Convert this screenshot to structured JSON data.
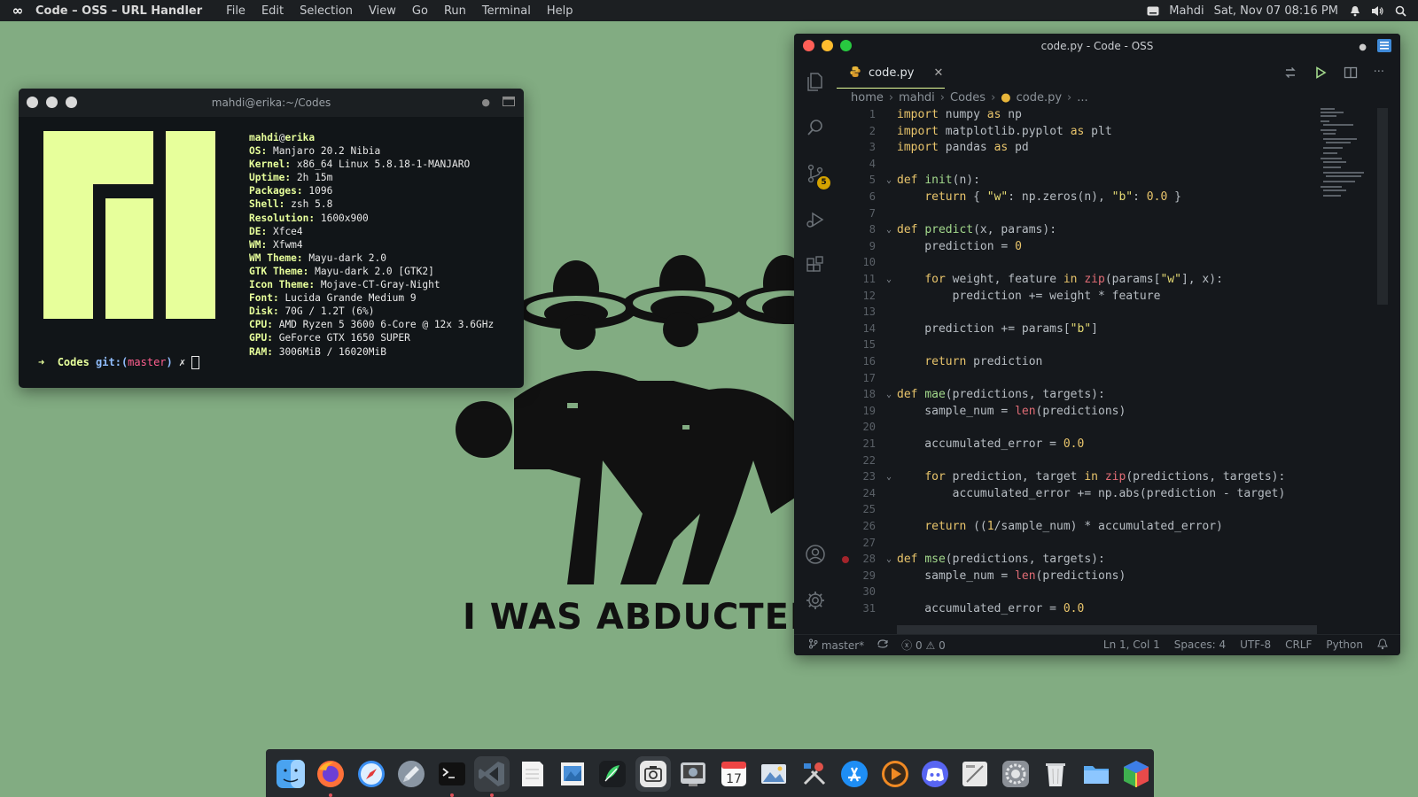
{
  "topbar": {
    "app_title": "Code – OSS – URL Handler",
    "menus": [
      "File",
      "Edit",
      "Selection",
      "View",
      "Go",
      "Run",
      "Terminal",
      "Help"
    ],
    "user": "Mahdi",
    "clock": "Sat, Nov 07 08:16 PM"
  },
  "wallpaper": {
    "caption": "I WAS ABDUCTED BY"
  },
  "terminal": {
    "title": "mahdi@erika:~/Codes",
    "user": "mahdi",
    "at": "@",
    "host": "erika",
    "info": [
      {
        "key": "OS:",
        "value": "Manjaro 20.2 Nibia"
      },
      {
        "key": "Kernel:",
        "value": "x86_64 Linux 5.8.18-1-MANJARO"
      },
      {
        "key": "Uptime:",
        "value": "2h 15m"
      },
      {
        "key": "Packages:",
        "value": "1096"
      },
      {
        "key": "Shell:",
        "value": "zsh 5.8"
      },
      {
        "key": "Resolution:",
        "value": "1600x900"
      },
      {
        "key": "DE:",
        "value": "Xfce4"
      },
      {
        "key": "WM:",
        "value": "Xfwm4"
      },
      {
        "key": "WM Theme:",
        "value": "Mayu-dark 2.0"
      },
      {
        "key": "GTK Theme:",
        "value": "Mayu-dark 2.0 [GTK2]"
      },
      {
        "key": "Icon Theme:",
        "value": "Mojave-CT-Gray-Night"
      },
      {
        "key": "Font:",
        "value": "Lucida Grande Medium 9"
      },
      {
        "key": "Disk:",
        "value": "70G / 1.2T (6%)"
      },
      {
        "key": "CPU:",
        "value": "AMD Ryzen 5 3600 6-Core @ 12x 3.6GHz"
      },
      {
        "key": "GPU:",
        "value": "GeForce GTX 1650 SUPER"
      },
      {
        "key": "RAM:",
        "value": "3006MiB / 16020MiB"
      }
    ],
    "prompt": {
      "arrow": "➜",
      "dir": "Codes",
      "git": "git:(",
      "branch": "master",
      "close": ")",
      "dirty": "✗"
    }
  },
  "vscode": {
    "title": "code.py - Code - OSS",
    "tab_label": "code.py",
    "scm_badge": "5",
    "breadcrumb": [
      "home",
      "mahdi",
      "Codes",
      "code.py",
      "..."
    ],
    "code_lines": [
      "import numpy as np",
      "import matplotlib.pyplot as plt",
      "import pandas as pd",
      "",
      "def init(n):",
      "    return { \"w\": np.zeros(n), \"b\": 0.0 }",
      "",
      "def predict(x, params):",
      "    prediction = 0",
      "",
      "    for weight, feature in zip(params[\"w\"], x):",
      "        prediction += weight * feature",
      "",
      "    prediction += params[\"b\"]",
      "",
      "    return prediction",
      "",
      "def mae(predictions, targets):",
      "    sample_num = len(predictions)",
      "",
      "    accumulated_error = 0.0",
      "",
      "    for prediction, target in zip(predictions, targets):",
      "        accumulated_error += np.abs(prediction - target)",
      "",
      "    return ((1/sample_num) * accumulated_error)",
      "",
      "def mse(predictions, targets):",
      "    sample_num = len(predictions)",
      "",
      "    accumulated_error = 0.0"
    ],
    "status": {
      "branch": "master*",
      "errors": "0",
      "warnings": "0",
      "position": "Ln 1, Col 1",
      "spaces": "Spaces: 4",
      "encoding": "UTF-8",
      "eol": "CRLF",
      "language": "Python"
    }
  },
  "dock": {
    "items": [
      "finder-icon",
      "firefox-icon",
      "safari-icon",
      "launchpad-icon",
      "terminal-icon",
      "vscode-icon",
      "notes-icon",
      "preview-icon",
      "feather-icon",
      "screenshot-icon",
      "photo-viewer-icon",
      "calendar-icon",
      "image-viewer-icon",
      "utilities-icon",
      "app-store-icon",
      "media-player-icon",
      "discord-icon",
      "mockup-icon",
      "system-preferences-icon",
      "trash-icon",
      "files-icon",
      "cube-icon"
    ],
    "calendar_day": "17"
  },
  "colors": {
    "accent": "#e7ff9b",
    "desktop": "#82ac82"
  }
}
